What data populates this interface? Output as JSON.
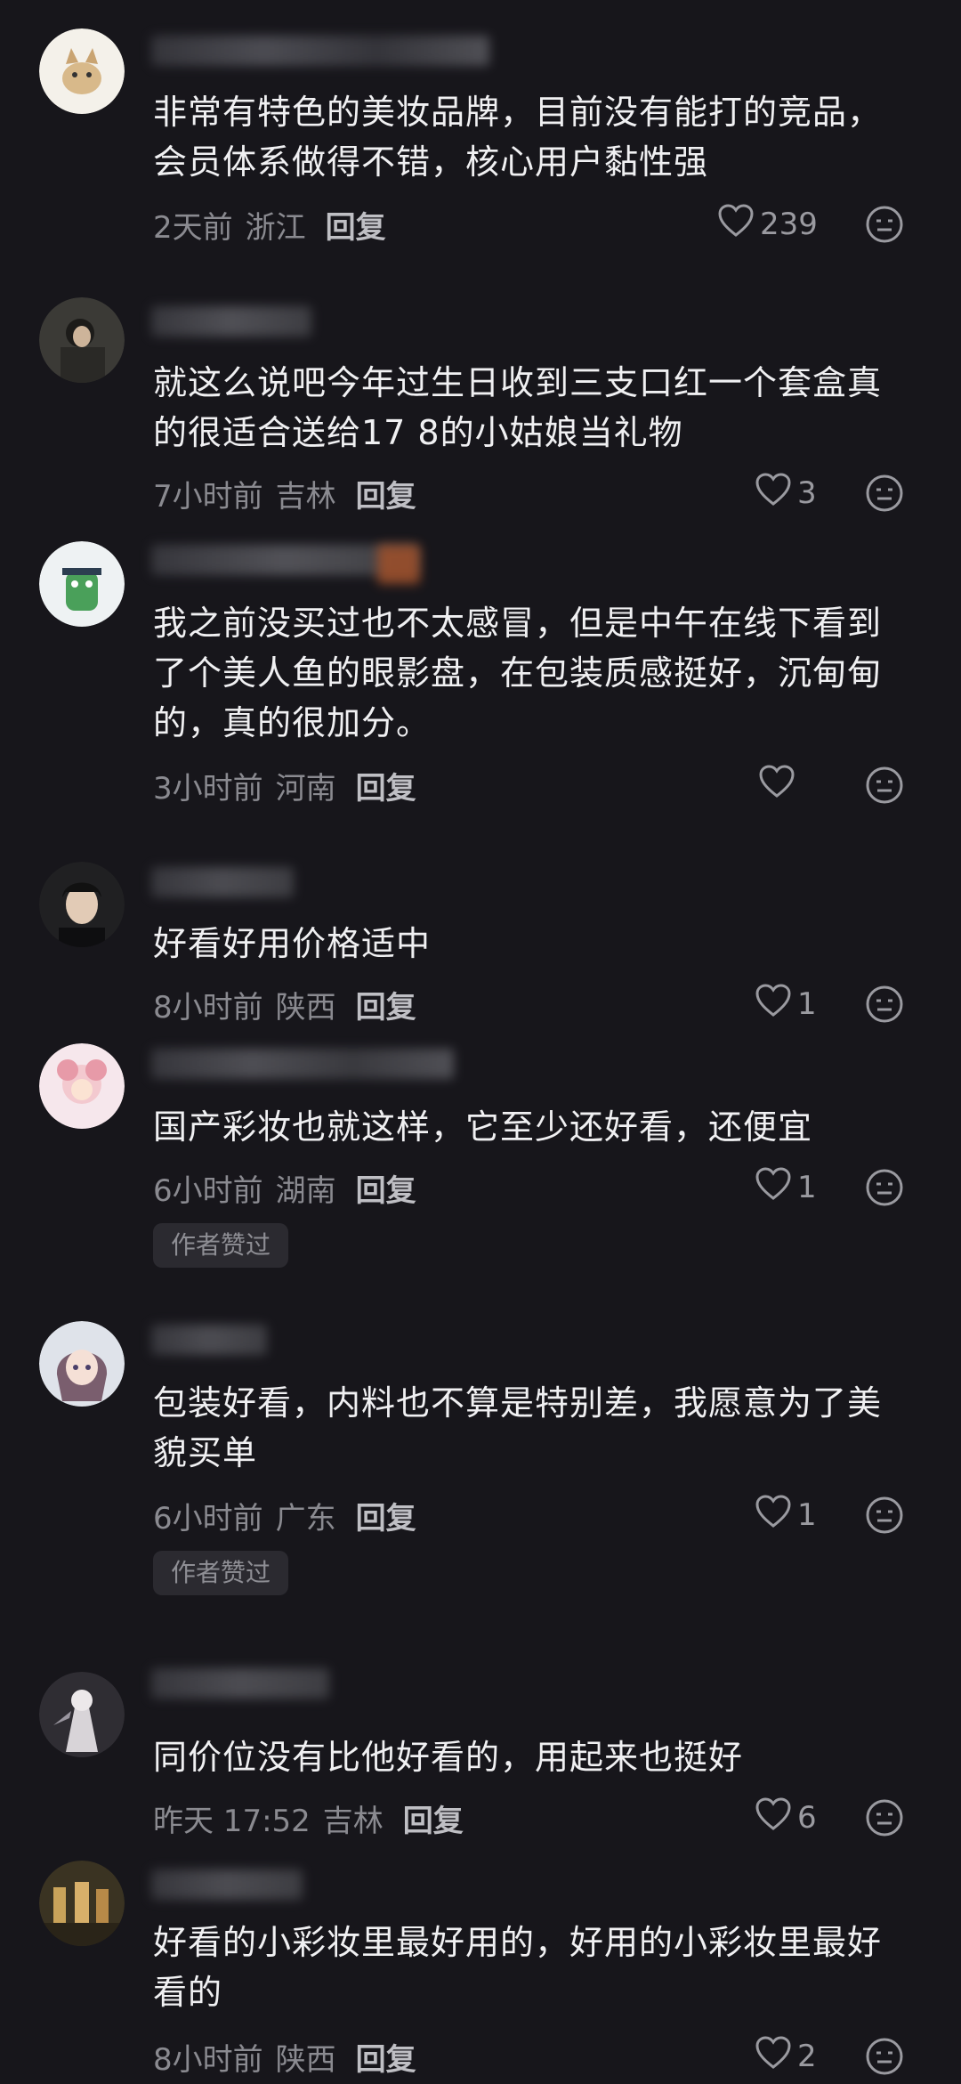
{
  "comments": [
    {
      "text": "非常有特色的美妆品牌，目前没有能打的竞品，会员体系做得不错，核心用户黏性强",
      "time": "2天前",
      "location": "浙江",
      "reply": "回复",
      "likes": "239",
      "badge": ""
    },
    {
      "text": "就这么说吧今年过生日收到三支口红一个套盒真的很适合送给17 8的小姑娘当礼物",
      "time": "7小时前",
      "location": "吉林",
      "reply": "回复",
      "likes": "3",
      "badge": ""
    },
    {
      "text": "我之前没买过也不太感冒，但是中午在线下看到了个美人鱼的眼影盘，在包装质感挺好，沉甸甸的，真的很加分。",
      "time": "3小时前",
      "location": "河南",
      "reply": "回复",
      "likes": "",
      "badge": ""
    },
    {
      "text": "好看好用价格适中",
      "time": "8小时前",
      "location": "陕西",
      "reply": "回复",
      "likes": "1",
      "badge": ""
    },
    {
      "text": "国产彩妆也就这样，它至少还好看，还便宜",
      "time": "6小时前",
      "location": "湖南",
      "reply": "回复",
      "likes": "1",
      "badge": "作者赞过"
    },
    {
      "text": "包装好看，内料也不算是特别差，我愿意为了美貌买单",
      "time": "6小时前",
      "location": "广东",
      "reply": "回复",
      "likes": "1",
      "badge": "作者赞过"
    },
    {
      "text": "同价位没有比他好看的，用起来也挺好",
      "time": "昨天 17:52",
      "location": "吉林",
      "reply": "回复",
      "likes": "6",
      "badge": ""
    },
    {
      "text": "好看的小彩妆里最好用的，好用的小彩妆里最好看的",
      "time": "8小时前",
      "location": "陕西",
      "reply": "回复",
      "likes": "2",
      "badge": ""
    }
  ],
  "icons": {
    "like": "heart-outline-icon",
    "dislike": "neutral-face-icon"
  },
  "colors": {
    "background": "#17161b",
    "text": "#f0f0f2",
    "meta": "#8a8a90"
  }
}
